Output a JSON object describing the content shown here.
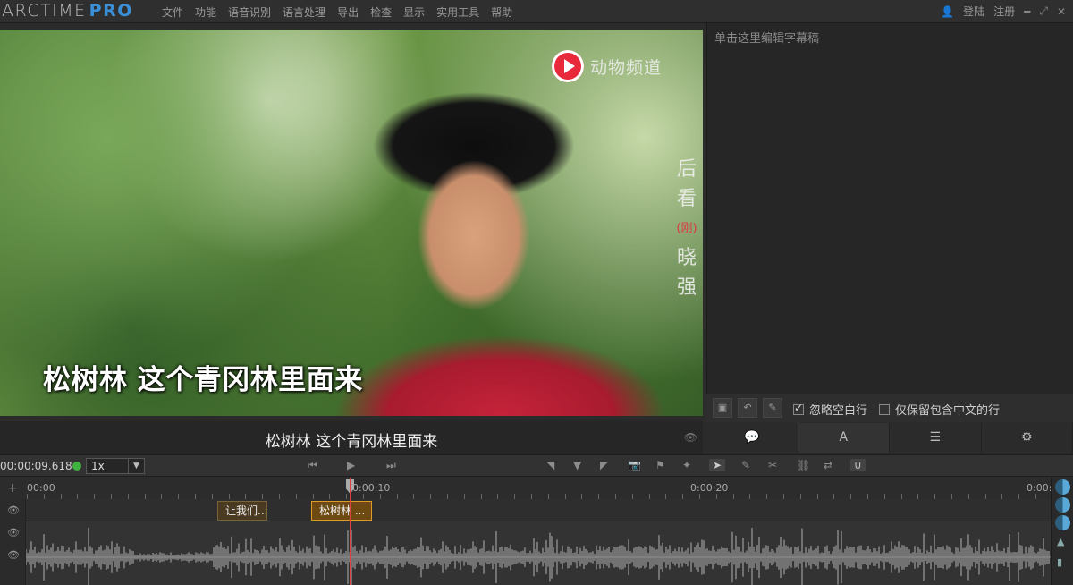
{
  "app": {
    "logo_main": "ARCTIME",
    "logo_pro": "PRO"
  },
  "menu": [
    "文件",
    "功能",
    "语音识别",
    "语言处理",
    "导出",
    "检查",
    "显示",
    "实用工具",
    "帮助"
  ],
  "account": {
    "login": "登陆",
    "register": "注册",
    "user_icon": "user-icon",
    "window_icons": [
      "minimize-icon",
      "expand-icon",
      "close-icon"
    ]
  },
  "video": {
    "watermark_text": "动物频道",
    "vertical_text": [
      "后",
      "看",
      "(刚)",
      "晓",
      "强"
    ],
    "subtitle": "松树林  这个青冈林里面来"
  },
  "caption_line": {
    "text": "松树林  这个青冈林里面来",
    "eye_icon": "eye-icon"
  },
  "editor": {
    "placeholder": "单击这里编辑字幕稿",
    "ignore_blank": "忽略空白行",
    "ignore_blank_checked": true,
    "keep_chinese": "仅保留包含中文的行",
    "keep_chinese_checked": false,
    "tabs": [
      "chat-icon",
      "font-icon",
      "list-icon",
      "gear-icon"
    ],
    "tab_glyphs": [
      "💬",
      "A",
      "☰",
      "⚙"
    ]
  },
  "transport": {
    "timecode": "00:00:09.618",
    "speed": "1x",
    "status_color": "#3fb23f"
  },
  "timeline": {
    "ticks": [
      "00:00",
      "0:00:10",
      "0:00:20",
      "0:00:"
    ],
    "clips": [
      {
        "label": "让我们..."
      },
      {
        "label": "松树林 ..."
      }
    ],
    "playhead_time": "00:00:09.618"
  }
}
